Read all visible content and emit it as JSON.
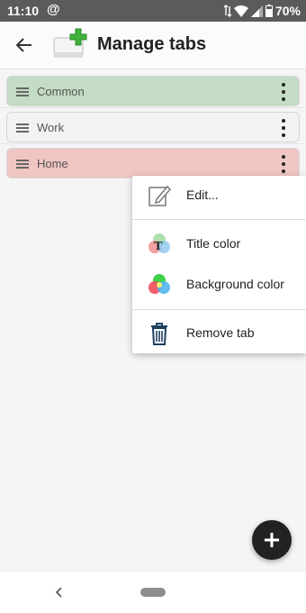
{
  "status_bar": {
    "time": "11:10",
    "at_symbol": "@",
    "battery": "70%"
  },
  "app_bar": {
    "title": "Manage tabs",
    "back_icon": "arrow-left-icon",
    "app_icon": "add-tab-icon"
  },
  "tabs": [
    {
      "label": "Common",
      "color": "#c4dcc3"
    },
    {
      "label": "Work",
      "color": "#f2f2f2"
    },
    {
      "label": "Home",
      "color": "#f0c6c3"
    }
  ],
  "context_menu": {
    "items": [
      {
        "label": "Edit...",
        "icon": "pencil-edit-icon"
      },
      {
        "label": "Title color",
        "icon": "title-color-icon"
      },
      {
        "label": "Background color",
        "icon": "background-color-icon"
      },
      {
        "label": "Remove tab",
        "icon": "trash-icon"
      }
    ]
  },
  "fab": {
    "icon": "plus-icon"
  },
  "colors": {
    "status_bar": "#5b5b5b",
    "fab": "#222222",
    "trash": "#1d3f5e"
  }
}
